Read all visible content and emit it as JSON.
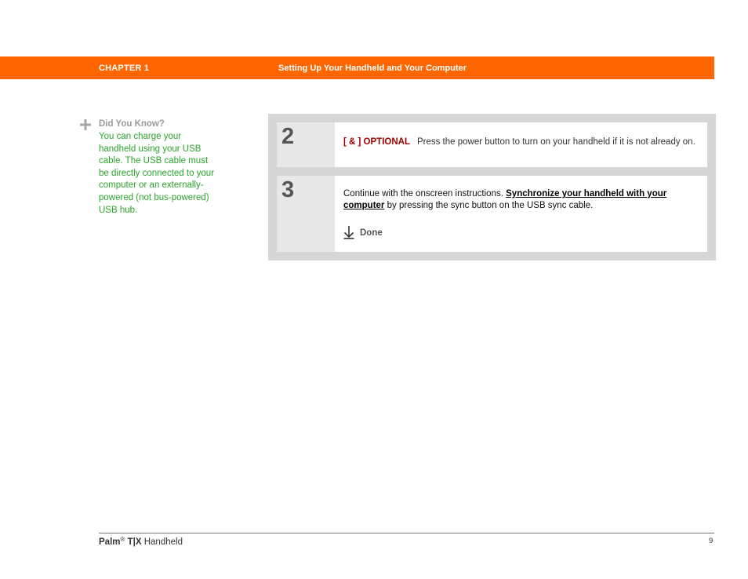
{
  "header": {
    "chapter": "CHAPTER 1",
    "title": "Setting Up Your Handheld and Your Computer",
    "color": "#ff6600"
  },
  "tip": {
    "icon": "plus-icon",
    "heading": "Did You Know?",
    "body": "You can charge your handheld using your USB cable. The USB cable must be directly connected to your computer or an externally-powered (not bus-powered) USB hub.",
    "color": "#2aa52a"
  },
  "steps": [
    {
      "number": "2",
      "tag": "[ & ]  OPTIONAL",
      "text": "Press the power button to turn on your handheld if it is not already on."
    },
    {
      "number": "3",
      "text_before": "Continue with the onscreen instructions. ",
      "link": "Synchronize your handheld with your computer",
      "text_after": " by pressing the sync button on the USB sync cable.",
      "done_icon": "down-arrow-icon",
      "done_label": "Done"
    }
  ],
  "footer": {
    "brand": "Palm",
    "reg": "®",
    "model": "T|X",
    "product": " Handheld",
    "page": "9"
  }
}
